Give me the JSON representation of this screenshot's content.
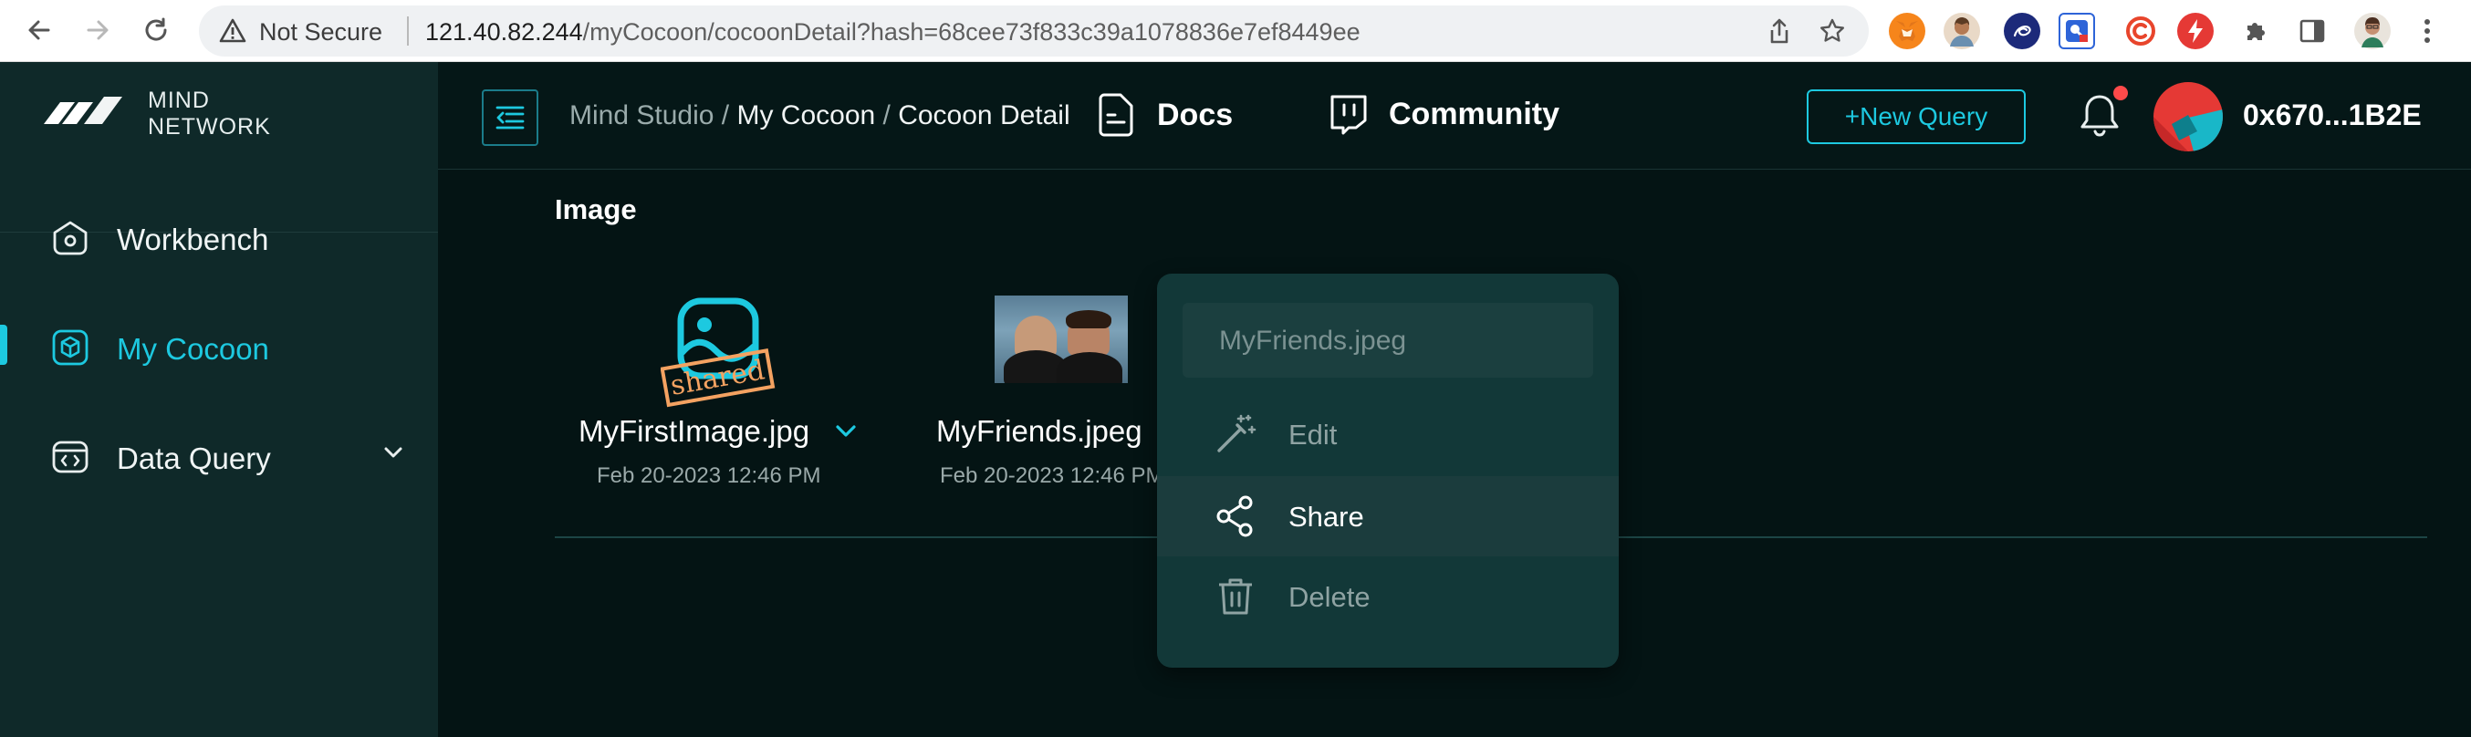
{
  "browser": {
    "security_label": "Not Secure",
    "url_host": "121.40.82.244",
    "url_path": "/myCocoon/cocoonDetail?hash=68cee73f833c39a1078836e7ef8449ee",
    "extensions": [
      "metamask-icon",
      "avatar-extension-icon",
      "wallet-extension-icon",
      "shield-extension-icon",
      "c-extension-icon",
      "bolt-extension-icon",
      "puzzle-icon",
      "sidepanel-icon",
      "profile-icon"
    ]
  },
  "brand": {
    "line1": "MIND",
    "line2": "NETWORK"
  },
  "sidebar": {
    "items": [
      {
        "label": "Workbench",
        "icon": "home-icon",
        "active": false
      },
      {
        "label": "My Cocoon",
        "icon": "cube-icon",
        "active": true
      },
      {
        "label": "Data Query",
        "icon": "code-window-icon",
        "active": false,
        "expandable": true
      }
    ]
  },
  "header": {
    "breadcrumb": {
      "part1": "Mind Studio",
      "sep": " / ",
      "part2": "My Cocoon",
      "part3": "Cocoon Detail"
    },
    "docs_label": "Docs",
    "community_label": "Community",
    "new_query_label": "+New Query",
    "has_notification": true,
    "address": "0x670...1B2E"
  },
  "content": {
    "section_title": "Image",
    "files": [
      {
        "name": "MyFirstImage.jpg",
        "date": "Feb 20-2023 12:46 PM",
        "stamp": "shared"
      },
      {
        "name": "MyFriends.jpeg",
        "date": "Feb 20-2023 12:46 PM"
      }
    ]
  },
  "context_menu": {
    "title": "MyFriends.jpeg",
    "items": [
      {
        "label": "Edit",
        "icon": "magic-wand-icon"
      },
      {
        "label": "Share",
        "icon": "share-icon",
        "highlighted": true
      },
      {
        "label": "Delete",
        "icon": "trash-icon"
      }
    ]
  },
  "colors": {
    "accent": "#1dc9e0",
    "sidebar_bg": "#0f2929",
    "page_bg": "#041414",
    "menu_bg": "#123838",
    "stamp": "#f4a261"
  }
}
